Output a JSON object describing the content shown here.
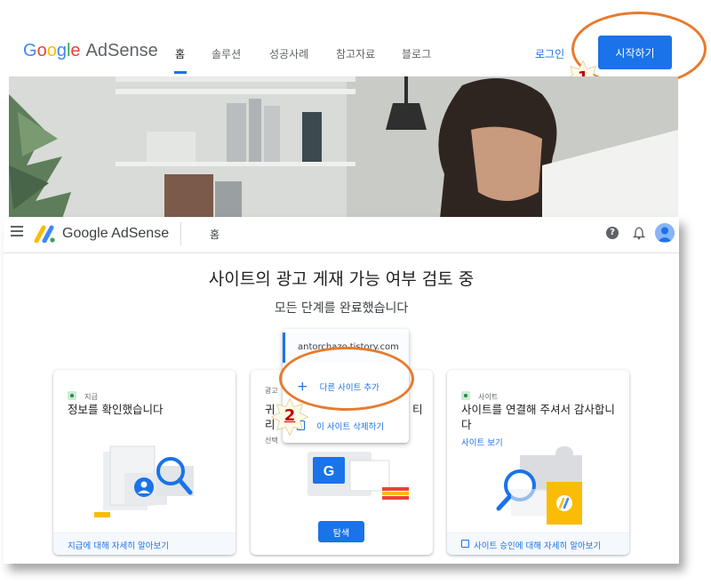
{
  "topbar": {
    "logo_google": "Google",
    "logo_product": "AdSense",
    "nav": [
      "홈",
      "솔루션",
      "성공사례",
      "참고자료",
      "블로그"
    ],
    "login": "로그인",
    "start": "시작하기"
  },
  "annotations": {
    "step1": "1",
    "step2": "2"
  },
  "app": {
    "title": "Google AdSense",
    "home": "홈",
    "help_glyph": "?",
    "heading": "사이트의 광고 게재 가능 여부 검토 중",
    "subheading": "모든 단계를 완료했습니다",
    "site_menu": {
      "current": "antorchazo.tistory.com",
      "add": "다른 사이트 추가",
      "remove": "이 사이트 삭제하기"
    },
    "cards": [
      {
        "label": "지급",
        "title": "정보를 확인했습니다",
        "footer": "지급에 대해 자세히 알아보기"
      },
      {
        "label_partial": "광고",
        "title_partial_l1": "귀",
        "title_partial_r1": "티",
        "title_partial_l2": "리",
        "desc_partial": "선택",
        "button": "탐색"
      },
      {
        "label": "사이트",
        "title": "사이트를 연결해 주셔서 감사합니다",
        "link": "사이트 보기",
        "footer": "사이트 승인에 대해 자세히 알아보기"
      }
    ]
  },
  "colors": {
    "accent": "#1a73e8",
    "annotation_ring": "#e87a2c",
    "annotation_number": "#c00000"
  }
}
